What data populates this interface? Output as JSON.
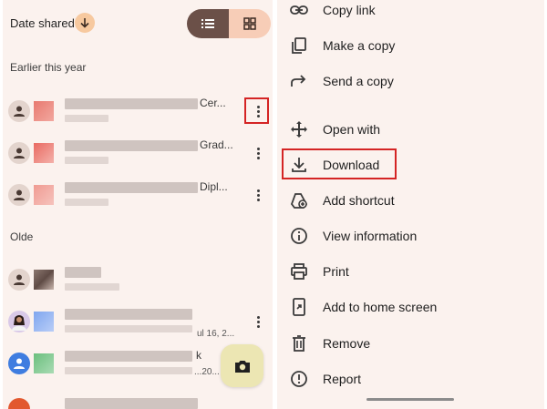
{
  "file_list": {
    "sort_label": "Date shared",
    "sections": {
      "recent": "Earlier this year",
      "older": "Olde"
    },
    "rows": [
      {
        "name_tail": "Cer...",
        "date": ""
      },
      {
        "name_tail": "Grad...",
        "date": ""
      },
      {
        "name_tail": "Dipl...",
        "date": ""
      },
      {
        "name_tail": "",
        "date": ""
      },
      {
        "name_tail": "",
        "date": "ul 16, 2..."
      },
      {
        "name_tail": "k",
        "date": "...20..."
      }
    ]
  },
  "menu": {
    "items": [
      {
        "label": "Copy link",
        "icon": "link-icon"
      },
      {
        "label": "Make a copy",
        "icon": "copy-icon"
      },
      {
        "label": "Send a copy",
        "icon": "forward-icon"
      },
      {
        "label": "Open with",
        "icon": "move-icon"
      },
      {
        "label": "Download",
        "icon": "download-icon"
      },
      {
        "label": "Add shortcut",
        "icon": "add-shortcut-icon"
      },
      {
        "label": "View information",
        "icon": "info-icon"
      },
      {
        "label": "Print",
        "icon": "printer-icon"
      },
      {
        "label": "Add to home screen",
        "icon": "home-screen-icon"
      },
      {
        "label": "Remove",
        "icon": "trash-icon"
      },
      {
        "label": "Report",
        "icon": "report-icon"
      }
    ]
  },
  "colors": {
    "panel_bg": "#fbf2ee",
    "highlight": "#d42424",
    "view_active": "#6b5048",
    "view_inactive": "#f7cdb7",
    "fab": "#ece6b3"
  }
}
